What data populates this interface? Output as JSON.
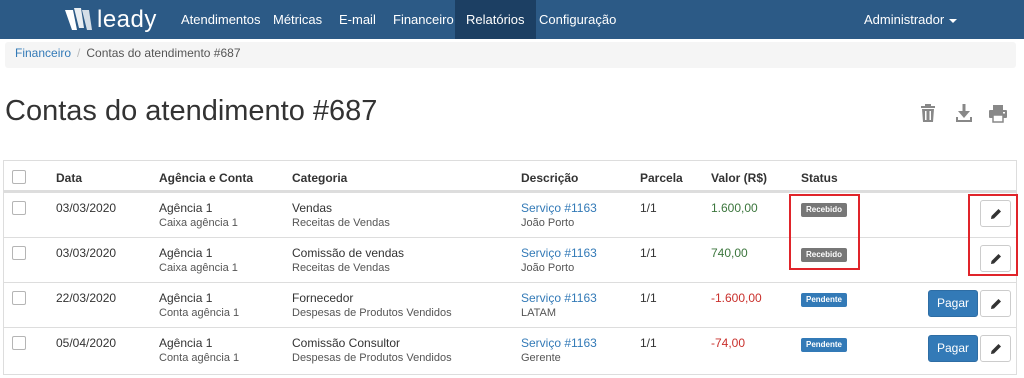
{
  "brand": {
    "name": "leady"
  },
  "nav": {
    "items": [
      {
        "label": "Atendimentos"
      },
      {
        "label": "Métricas"
      },
      {
        "label": "E-mail"
      },
      {
        "label": "Financeiro"
      },
      {
        "label": "Relatórios"
      },
      {
        "label": "Configuração"
      }
    ],
    "active": "Relatórios",
    "user": "Administrador"
  },
  "breadcrumb": {
    "parent": "Financeiro",
    "current": "Contas do atendimento #687"
  },
  "page": {
    "title": "Contas do atendimento #687",
    "actions": [
      "trash-icon",
      "download-icon",
      "print-icon"
    ]
  },
  "table": {
    "headers": {
      "date": "Data",
      "agency": "Agência e Conta",
      "category": "Categoria",
      "description": "Descrição",
      "installment": "Parcela",
      "amount": "Valor (R$)",
      "status": "Status"
    },
    "rows": [
      {
        "date": "03/03/2020",
        "agency": "Agência 1",
        "account": "Caixa agência 1",
        "category": "Vendas",
        "subcategory": "Receitas de Vendas",
        "service": "Serviço #1163",
        "person": "João Porto",
        "installment": "1/1",
        "amount": "1.600,00",
        "status": "Recebido",
        "pay_label": ""
      },
      {
        "date": "03/03/2020",
        "agency": "Agência 1",
        "account": "Caixa agência 1",
        "category": "Comissão de vendas",
        "subcategory": "Receitas de Vendas",
        "service": "Serviço #1163",
        "person": "João Porto",
        "installment": "1/1",
        "amount": "740,00",
        "status": "Recebido",
        "pay_label": ""
      },
      {
        "date": "22/03/2020",
        "agency": "Agência 1",
        "account": "Conta agência 1",
        "category": "Fornecedor",
        "subcategory": "Despesas de Produtos Vendidos",
        "service": "Serviço #1163",
        "person": "LATAM",
        "installment": "1/1",
        "amount": "-1.600,00",
        "status": "Pendente",
        "pay_label": "Pagar"
      },
      {
        "date": "05/04/2020",
        "agency": "Agência 1",
        "account": "Conta agência 1",
        "category": "Comissão Consultor",
        "subcategory": "Despesas de Produtos Vendidos",
        "service": "Serviço #1163",
        "person": "Gerente",
        "installment": "1/1",
        "amount": "-74,00",
        "status": "Pendente",
        "pay_label": "Pagar"
      }
    ]
  },
  "colors": {
    "navbar": "#2c5a86",
    "nav_active": "#1c3f63",
    "link": "#337ab7",
    "positive": "#3c763d",
    "negative": "#c9302c",
    "badge_received": "#777777",
    "badge_pending": "#337ab7",
    "highlight": "#e0242a"
  }
}
